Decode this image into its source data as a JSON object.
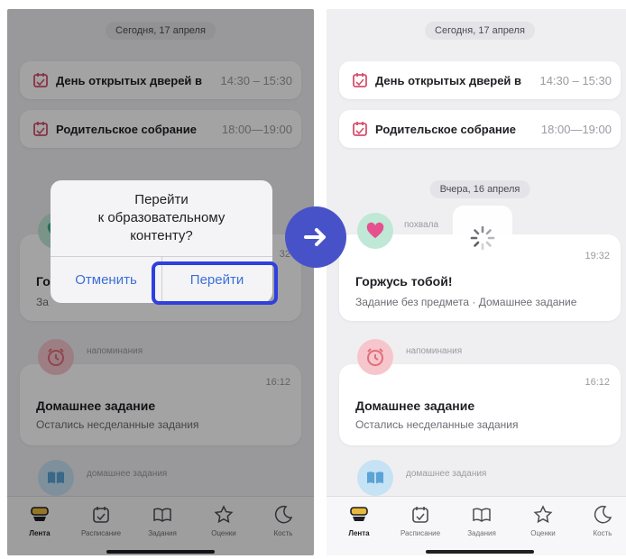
{
  "colors": {
    "accent": "#3a6fd8",
    "highlight": "#2f3fe0",
    "arrow_bg": "#4852c8",
    "event_icon": "#d5506c",
    "praise_icon": "#3fae86",
    "reminder_icon": "#e06e7a",
    "homework_icon": "#5aa3d6"
  },
  "left_screen": {
    "date_today": "Сегодня, 17 апреля",
    "events": [
      {
        "title": "День открытых дверей в",
        "time": "14:30 – 15:30",
        "icon": "calendar-icon"
      },
      {
        "title": "Родительское собрание",
        "time": "18:00—19:00",
        "icon": "calendar-icon"
      }
    ],
    "partial_card": {
      "title_fragment": "Го",
      "subtitle_fragment": "За",
      "time_fragment": "32"
    },
    "reminder": {
      "category": "напоминания",
      "time": "16:12",
      "title": "Домашнее задание",
      "subtitle": "Остались несделанные задания",
      "icon": "alarm-clock-icon"
    },
    "homework": {
      "category": "домашнее задания",
      "icon": "open-book-icon"
    },
    "dialog": {
      "message_line1": "Перейти",
      "message_line2": "к образовательному",
      "message_line3": "контенту?",
      "cancel_label": "Отменить",
      "confirm_label": "Перейти"
    }
  },
  "right_screen": {
    "date_today": "Сегодня, 17 апреля",
    "events": [
      {
        "title": "День открытых дверей в",
        "time": "14:30 – 15:30",
        "icon": "calendar-icon"
      },
      {
        "title": "Родительское собрание",
        "time": "18:00—19:00",
        "icon": "calendar-icon"
      }
    ],
    "date_yesterday": "Вчера, 16 апреля",
    "praise": {
      "category": "похвала",
      "time": "19:32",
      "title": "Горжусь тобой!",
      "subtitle": "Задание без предмета · Домашнее задание",
      "icon": "heart-icon"
    },
    "reminder": {
      "category": "напоминания",
      "time": "16:12",
      "title": "Домашнее задание",
      "subtitle": "Остались несделанные задания",
      "icon": "alarm-clock-icon"
    },
    "homework": {
      "category": "домашнее задания",
      "icon": "open-book-icon"
    }
  },
  "tabbar": {
    "tabs": [
      {
        "label": "Лента",
        "icon": "feed-icon",
        "active": true
      },
      {
        "label": "Расписание",
        "icon": "calendar-icon",
        "active": false
      },
      {
        "label": "Задания",
        "icon": "book-icon",
        "active": false
      },
      {
        "label": "Оценки",
        "icon": "star-icon",
        "active": false
      },
      {
        "label": "Кость",
        "icon": "moon-icon",
        "active": false
      }
    ]
  },
  "transition_icon": "arrow-right-icon"
}
